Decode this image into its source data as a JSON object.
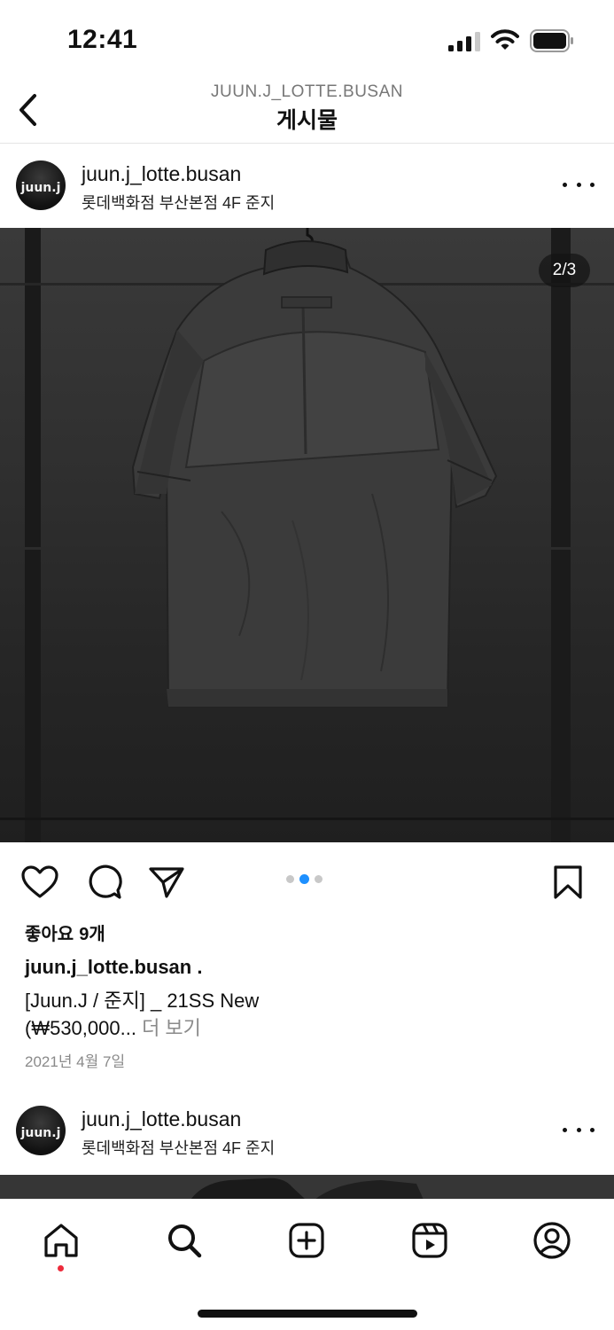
{
  "status_bar": {
    "time": "12:41"
  },
  "nav": {
    "account_handle": "JUUN.J_LOTTE.BUSAN",
    "title": "게시물"
  },
  "post": {
    "username": "juun.j_lotte.busan",
    "location": "롯데백화점 부산본점 4F 준지",
    "avatar_text": "juun.j",
    "carousel_counter": "2/3",
    "carousel": {
      "total": 3,
      "active_index": 2
    },
    "likes_label": "좋아요",
    "likes_count": "9개",
    "caption_user": "juun.j_lotte.busan .",
    "caption_line1": "[Juun.J / 준지] _ 21SS New",
    "caption_line2": "(₩530,000...",
    "more_label": "더 보기",
    "date": "2021년 4월 7일"
  },
  "next_post": {
    "username": "juun.j_lotte.busan",
    "location": "롯데백화점 부산본점 4F 준지",
    "avatar_text": "juun.j"
  },
  "icons": {
    "back": "chevron-left-icon",
    "more": "more-horizontal-icon",
    "like": "heart-icon",
    "comment": "comment-icon",
    "share": "send-icon",
    "save": "bookmark-icon",
    "tabs": [
      "home-icon",
      "search-icon",
      "add-post-icon",
      "reels-icon",
      "profile-icon"
    ]
  },
  "colors": {
    "accent_blue": "#1e90ff",
    "notification_red": "#ed2b3b",
    "secondary_text": "#8a8a8a"
  }
}
